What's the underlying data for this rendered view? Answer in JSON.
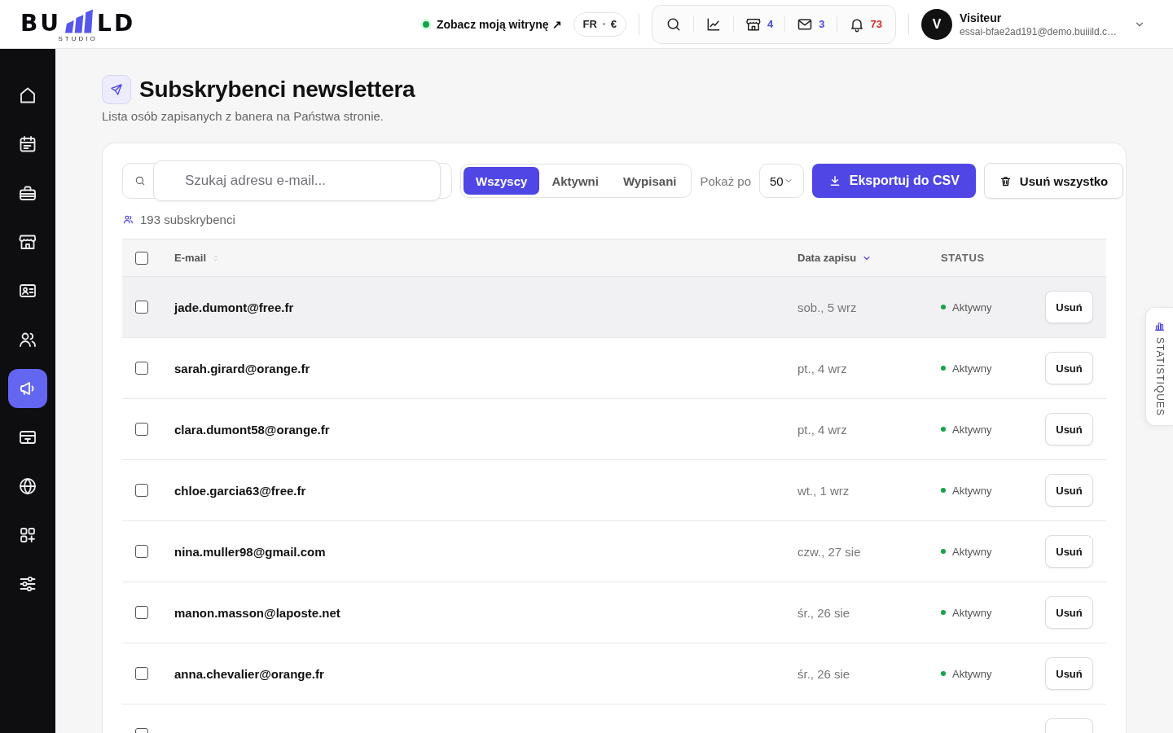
{
  "topbar": {
    "logo": {
      "left": "BU",
      "right": "LD",
      "tagline": "STUDIO"
    },
    "site_link": {
      "label": "Zobacz moją witrynę ↗",
      "online": true
    },
    "locale": {
      "language": "FR",
      "currency": "€"
    },
    "actions": [
      {
        "kind": "search"
      },
      {
        "kind": "chart"
      },
      {
        "kind": "store",
        "count": "4",
        "color": "#4f46e5"
      },
      {
        "kind": "mail",
        "count": "3",
        "color": "#4f46e5"
      },
      {
        "kind": "bell",
        "count": "73",
        "color": "#dc2626"
      }
    ],
    "user": {
      "initial": "V",
      "name": "Visiteur",
      "email": "essai-bfae2ad191@demo.buiiild.c…"
    }
  },
  "sidebar": {
    "items": [
      {
        "kind": "home",
        "selected": false
      },
      {
        "kind": "calendar",
        "selected": false
      },
      {
        "kind": "toolbox",
        "selected": false
      },
      {
        "kind": "store",
        "selected": false
      },
      {
        "kind": "contacts",
        "selected": false
      },
      {
        "kind": "users",
        "selected": false
      },
      {
        "kind": "megaphone",
        "selected": true
      },
      {
        "kind": "card",
        "selected": false
      },
      {
        "kind": "globe",
        "selected": false
      },
      {
        "kind": "apps",
        "selected": false
      },
      {
        "kind": "sliders",
        "selected": false
      }
    ]
  },
  "page": {
    "title": "Subskrybenci newslettera",
    "subtitle": "Lista osób zapisanych z banera na Państwa stronie."
  },
  "toolbar": {
    "search": {
      "placeholder": "Szukaj adresu e-mail..."
    },
    "filters": [
      {
        "label": "Wszyscy",
        "selected": true
      },
      {
        "label": "Aktywni",
        "selected": false
      },
      {
        "label": "Wypisani",
        "selected": false
      }
    ],
    "page_size": {
      "label": "Pokaż po",
      "value": "50"
    },
    "export_button": {
      "label": "Eksportuj do CSV"
    },
    "delete_all_button": {
      "label": "Usuń wszystko"
    }
  },
  "summary": {
    "count": "193 subskrybenci"
  },
  "table": {
    "select_all": {
      "checked": false
    },
    "columns": [
      {
        "label": "E-mail",
        "sortable": true,
        "sorted": false
      },
      {
        "label": "Data zapisu",
        "sortable": true,
        "sorted": true
      },
      {
        "label": "STATUS",
        "sortable": false
      }
    ],
    "rows": [
      {
        "email": "jade.dumont@free.fr",
        "date": "sob., 5 wrz",
        "status": {
          "label": "Aktywny",
          "color": "#16a34a"
        },
        "checked": false,
        "hovered": true,
        "action": "Usuń"
      },
      {
        "email": "sarah.girard@orange.fr",
        "date": "pt., 4 wrz",
        "status": {
          "label": "Aktywny",
          "color": "#16a34a"
        },
        "checked": false,
        "hovered": false,
        "action": "Usuń"
      },
      {
        "email": "clara.dumont58@orange.fr",
        "date": "pt., 4 wrz",
        "status": {
          "label": "Aktywny",
          "color": "#16a34a"
        },
        "checked": false,
        "hovered": false,
        "action": "Usuń"
      },
      {
        "email": "chloe.garcia63@free.fr",
        "date": "wt., 1 wrz",
        "status": {
          "label": "Aktywny",
          "color": "#16a34a"
        },
        "checked": false,
        "hovered": false,
        "action": "Usuń"
      },
      {
        "email": "nina.muller98@gmail.com",
        "date": "czw., 27 sie",
        "status": {
          "label": "Aktywny",
          "color": "#16a34a"
        },
        "checked": false,
        "hovered": false,
        "action": "Usuń"
      },
      {
        "email": "manon.masson@laposte.net",
        "date": "śr., 26 sie",
        "status": {
          "label": "Aktywny",
          "color": "#16a34a"
        },
        "checked": false,
        "hovered": false,
        "action": "Usuń"
      },
      {
        "email": "anna.chevalier@orange.fr",
        "date": "śr., 26 sie",
        "status": {
          "label": "Aktywny",
          "color": "#16a34a"
        },
        "checked": false,
        "hovered": false,
        "action": "Usuń"
      },
      {
        "checked": false,
        "hovered": false
      }
    ]
  },
  "statistics_tab": {
    "label": "STATISTIQUES"
  }
}
